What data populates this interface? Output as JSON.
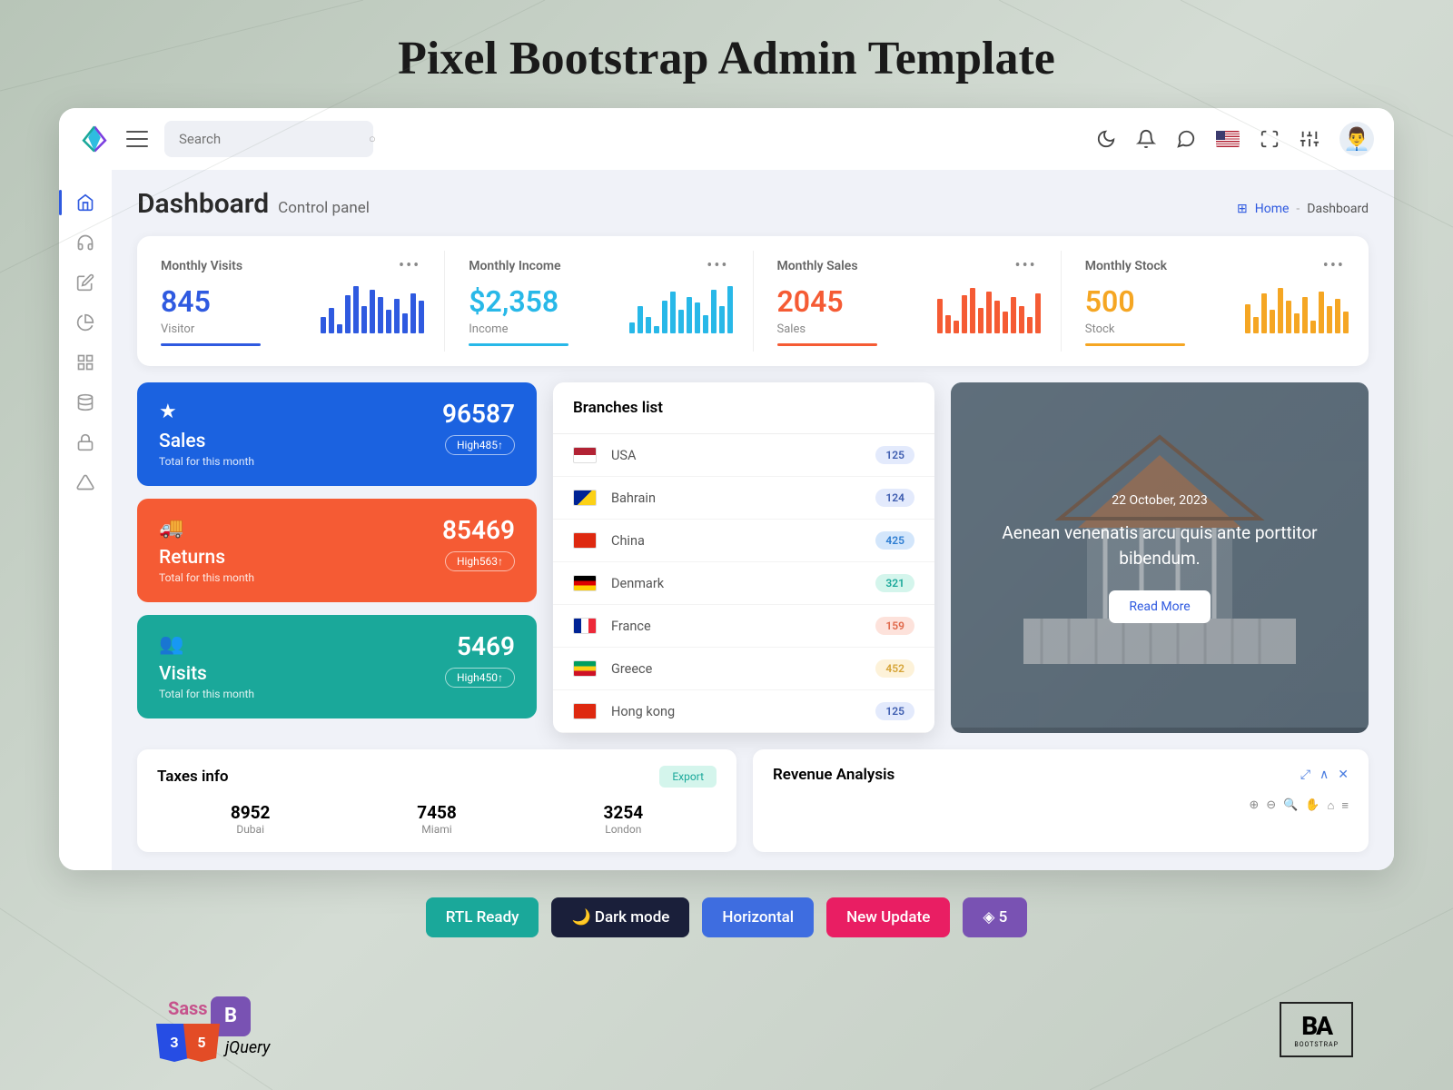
{
  "hero_title": "Pixel Bootstrap Admin Template",
  "search": {
    "placeholder": "Search"
  },
  "page": {
    "title": "Dashboard",
    "subtitle": "Control panel"
  },
  "breadcrumb": {
    "home": "Home",
    "current": "Dashboard"
  },
  "stats": [
    {
      "label": "Monthly Visits",
      "value": "845",
      "sub": "Visitor",
      "color": "#2f5ae0",
      "bars": [
        18,
        28,
        10,
        42,
        52,
        30,
        48,
        40,
        26,
        38,
        22,
        44,
        36
      ]
    },
    {
      "label": "Monthly Income",
      "value": "$2,358",
      "sub": "Income",
      "color": "#28b8e8",
      "bars": [
        12,
        30,
        18,
        8,
        36,
        46,
        26,
        40,
        34,
        20,
        48,
        30,
        52
      ]
    },
    {
      "label": "Monthly Sales",
      "value": "2045",
      "sub": "Sales",
      "color": "#f55b34",
      "bars": [
        38,
        20,
        14,
        42,
        50,
        28,
        46,
        36,
        24,
        40,
        30,
        18,
        44
      ]
    },
    {
      "label": "Monthly Stock",
      "value": "500",
      "sub": "Stock",
      "color": "#f5a623",
      "bars": [
        32,
        18,
        44,
        26,
        50,
        36,
        22,
        40,
        14,
        46,
        30,
        38,
        24
      ]
    }
  ],
  "tiles": [
    {
      "icon": "★",
      "title": "Sales",
      "sub": "Total for this month",
      "value": "96587",
      "badge": "High485↑"
    },
    {
      "icon": "🚚",
      "title": "Returns",
      "sub": "Total for this month",
      "value": "85469",
      "badge": "High563↑"
    },
    {
      "icon": "👥",
      "title": "Visits",
      "sub": "Total for this month",
      "value": "5469",
      "badge": "High450↑"
    }
  ],
  "branches": {
    "title": "Branches list",
    "items": [
      {
        "name": "USA",
        "count": "125",
        "flag": "us",
        "badge_bg": "#e3eafc",
        "badge_fg": "#3e5db0"
      },
      {
        "name": "Bahrain",
        "count": "124",
        "flag": "bh",
        "badge_bg": "#e3eafc",
        "badge_fg": "#3e5db0"
      },
      {
        "name": "China",
        "count": "425",
        "flag": "ch",
        "badge_bg": "#d3e6fb",
        "badge_fg": "#2d7dd2"
      },
      {
        "name": "Denmark",
        "count": "321",
        "flag": "de",
        "badge_bg": "#d4f5ec",
        "badge_fg": "#1aa89a"
      },
      {
        "name": "France",
        "count": "159",
        "flag": "fr",
        "badge_bg": "#fde2db",
        "badge_fg": "#e0684a"
      },
      {
        "name": "Greece",
        "count": "452",
        "flag": "gr",
        "badge_bg": "#fdf2d9",
        "badge_fg": "#d6a437"
      },
      {
        "name": "Hong kong",
        "count": "125",
        "flag": "hk",
        "badge_bg": "#e3eafc",
        "badge_fg": "#3e5db0"
      }
    ]
  },
  "promo": {
    "date": "22 October, 2023",
    "text": "Aenean venenatis arcu quis ante porttitor bibendum.",
    "button": "Read More"
  },
  "taxes": {
    "title": "Taxes info",
    "export": "Export",
    "items": [
      {
        "value": "8952",
        "city": "Dubai"
      },
      {
        "value": "7458",
        "city": "Miami"
      },
      {
        "value": "3254",
        "city": "London"
      }
    ]
  },
  "revenue": {
    "title": "Revenue Analysis"
  },
  "footer": {
    "btns": [
      {
        "label": "RTL Ready",
        "bg": "#1aa89a"
      },
      {
        "label": "Dark mode",
        "bg": "#1a1f3a",
        "icon": "🌙"
      },
      {
        "label": "Horizontal",
        "bg": "#3e6de0"
      },
      {
        "label": "New Update",
        "bg": "#e91e63"
      },
      {
        "label": "5",
        "bg": "#7952b3",
        "icon": "◈"
      }
    ],
    "ba": {
      "big": "BA",
      "small": "BOOTSTRAP"
    }
  }
}
